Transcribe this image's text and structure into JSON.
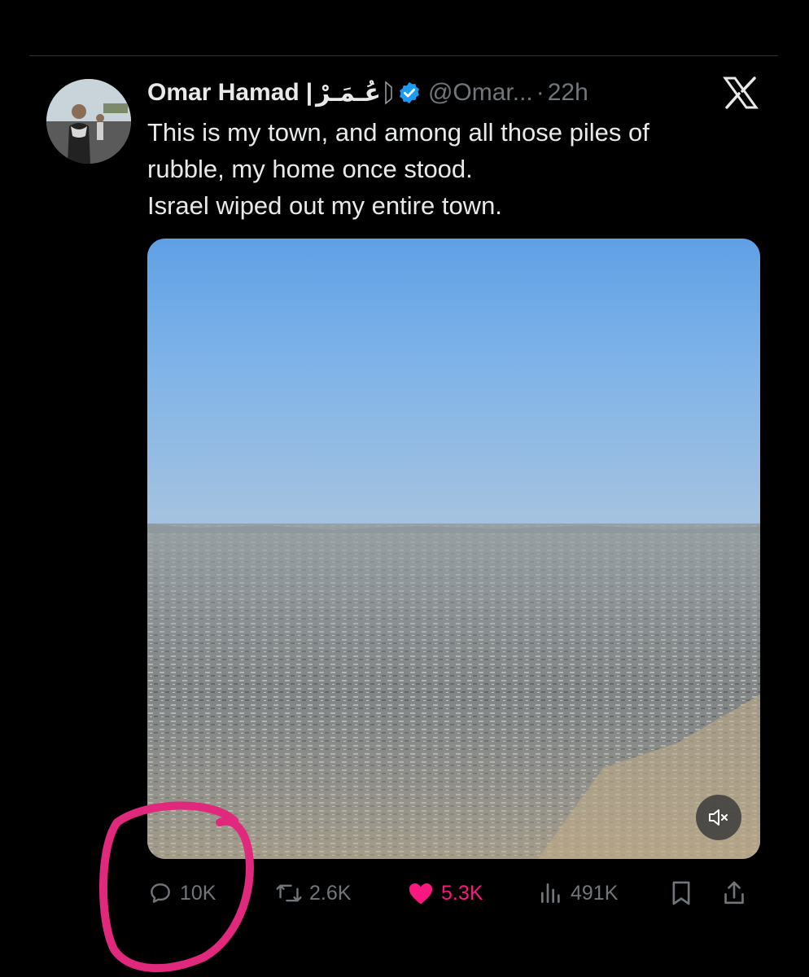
{
  "tweet": {
    "author_name": "Omar Hamad",
    "name_separator": "|",
    "author_name_arabic": "عُـمَـرْ",
    "handle": "@Omar...",
    "separator": "·",
    "time": "22h",
    "text_lines": [
      "This is my town, and among all those piles of",
      "rubble, my home once stood.",
      "Israel wiped out my entire town."
    ]
  },
  "actions": {
    "replies": "10K",
    "reposts": "2.6K",
    "likes": "5.3K",
    "views": "491K"
  },
  "colors": {
    "background": "#000000",
    "text": "#e7e9ea",
    "muted": "#71767b",
    "verified": "#1d9bf0",
    "like": "#f91880",
    "annotation": "#e0287d"
  },
  "icons": [
    "verified-badge-icon",
    "x-logo-icon",
    "reply-icon",
    "repost-icon",
    "like-icon",
    "views-icon",
    "bookmark-icon",
    "share-icon",
    "mute-icon"
  ]
}
